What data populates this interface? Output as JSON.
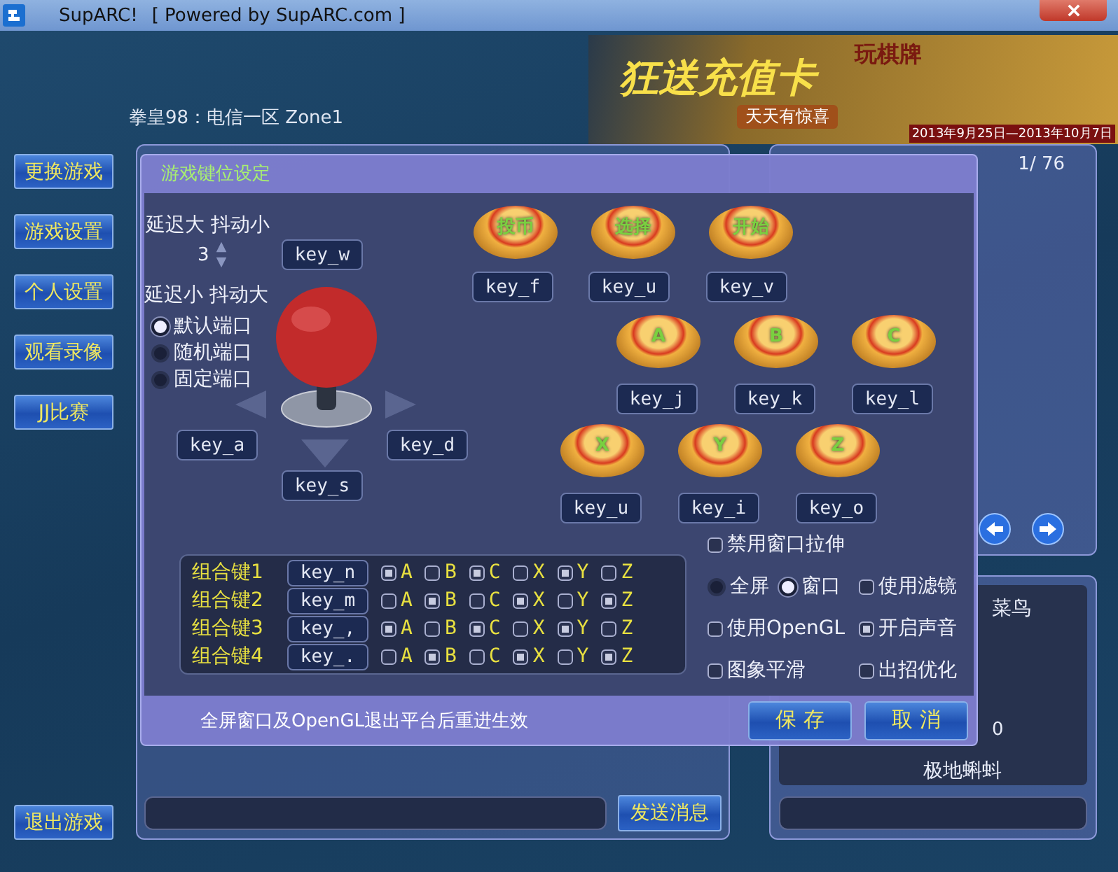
{
  "window": {
    "title": "SupARC!",
    "subtitle": "[ Powered by SupARC.com ]"
  },
  "header": {
    "server": "拳皇98：电信一区  Zone1",
    "banner": {
      "headline": "狂送充值卡",
      "tag": "玩棋牌",
      "slogan": "天天有惊喜",
      "dates": "2013年9月25日—2013年10月7日"
    }
  },
  "sidebar": {
    "buttons": [
      "更换游戏",
      "游戏设置",
      "个人设置",
      "观看录像",
      "JJ比赛"
    ],
    "exit": "退出游戏"
  },
  "chat": {
    "send": "发送消息"
  },
  "contacts": {
    "page": "1/ 76"
  },
  "profile": {
    "rank": "菜鸟",
    "value": "0",
    "name": "极地蝌蚪"
  },
  "dialog": {
    "title": "游戏键位设定",
    "latency_high": "延迟大 抖动小",
    "spinner": "3",
    "latency_low": "延迟小 抖动大",
    "ports": [
      {
        "label": "默认端口",
        "selected": true
      },
      {
        "label": "随机端口",
        "selected": false
      },
      {
        "label": "固定端口",
        "selected": false
      }
    ],
    "directions": {
      "up": "key_w",
      "left": "key_a",
      "right": "key_d",
      "down": "key_s"
    },
    "buttons": [
      {
        "label": "投币",
        "key": "key_f"
      },
      {
        "label": "选择",
        "key": "key_u"
      },
      {
        "label": "开始",
        "key": "key_v"
      },
      {
        "label": "A",
        "key": "key_j"
      },
      {
        "label": "B",
        "key": "key_k"
      },
      {
        "label": "C",
        "key": "key_l"
      },
      {
        "label": "X",
        "key": "key_u"
      },
      {
        "label": "Y",
        "key": "key_i"
      },
      {
        "label": "Z",
        "key": "key_o"
      }
    ],
    "combos": [
      {
        "label": "组合键1",
        "key": "key_n",
        "options": [
          {
            "label": "A",
            "checked": true
          },
          {
            "label": "B",
            "checked": false
          },
          {
            "label": "C",
            "checked": true
          },
          {
            "label": "X",
            "checked": false
          },
          {
            "label": "Y",
            "checked": true
          },
          {
            "label": "Z",
            "checked": false
          }
        ]
      },
      {
        "label": "组合键2",
        "key": "key_m",
        "options": [
          {
            "label": "A",
            "checked": false
          },
          {
            "label": "B",
            "checked": true
          },
          {
            "label": "C",
            "checked": false
          },
          {
            "label": "X",
            "checked": true
          },
          {
            "label": "Y",
            "checked": false
          },
          {
            "label": "Z",
            "checked": true
          }
        ]
      },
      {
        "label": "组合键3",
        "key": "key_,",
        "options": [
          {
            "label": "A",
            "checked": true
          },
          {
            "label": "B",
            "checked": false
          },
          {
            "label": "C",
            "checked": true
          },
          {
            "label": "X",
            "checked": false
          },
          {
            "label": "Y",
            "checked": true
          },
          {
            "label": "Z",
            "checked": false
          }
        ]
      },
      {
        "label": "组合键4",
        "key": "key_.",
        "options": [
          {
            "label": "A",
            "checked": false
          },
          {
            "label": "B",
            "checked": true
          },
          {
            "label": "C",
            "checked": false
          },
          {
            "label": "X",
            "checked": true
          },
          {
            "label": "Y",
            "checked": false
          },
          {
            "label": "Z",
            "checked": true
          }
        ]
      }
    ],
    "option_rows": [
      {
        "items": [
          {
            "kind": "checkbox",
            "label": "禁用窗口拉伸",
            "checked": false
          }
        ]
      },
      {
        "items": [
          {
            "kind": "radio",
            "label": "全屏",
            "selected": false
          },
          {
            "kind": "radio",
            "label": "窗口",
            "selected": true
          },
          {
            "kind": "checkbox",
            "label": "使用滤镜",
            "checked": false
          }
        ]
      },
      {
        "items": [
          {
            "kind": "checkbox",
            "label": "使用OpenGL",
            "checked": false
          },
          {
            "kind": "checkbox",
            "label": "开启声音",
            "checked": true
          }
        ]
      },
      {
        "items": [
          {
            "kind": "checkbox",
            "label": "图象平滑",
            "checked": false
          },
          {
            "kind": "checkbox",
            "label": "出招优化",
            "checked": false
          }
        ]
      }
    ],
    "notice": "全屏窗口及OpenGL退出平台后重进生效",
    "actions": [
      "保 存",
      "取 消"
    ]
  }
}
